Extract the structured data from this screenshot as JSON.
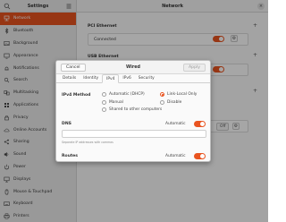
{
  "sidebar": {
    "title": "Settings",
    "items": [
      {
        "label": "Network",
        "icon": "network-icon",
        "active": true
      },
      {
        "label": "Bluetooth",
        "icon": "bluetooth-icon"
      },
      {
        "label": "Background",
        "icon": "background-icon"
      },
      {
        "label": "Appearance",
        "icon": "appearance-icon"
      },
      {
        "label": "Notifications",
        "icon": "bell-icon"
      },
      {
        "label": "Search",
        "icon": "search-icon"
      },
      {
        "label": "Multitasking",
        "icon": "multitasking-icon"
      },
      {
        "label": "Applications",
        "icon": "applications-icon",
        "chevron": true
      },
      {
        "label": "Privacy",
        "icon": "privacy-icon",
        "chevron": true
      },
      {
        "label": "Online Accounts",
        "icon": "cloud-icon"
      },
      {
        "label": "Sharing",
        "icon": "sharing-icon"
      },
      {
        "label": "Sound",
        "icon": "sound-icon"
      },
      {
        "label": "Power",
        "icon": "power-icon"
      },
      {
        "label": "Displays",
        "icon": "display-icon"
      },
      {
        "label": "Mouse & Touchpad",
        "icon": "mouse-icon"
      },
      {
        "label": "Keyboard",
        "icon": "keyboard-icon"
      },
      {
        "label": "Printers",
        "icon": "printer-icon"
      }
    ]
  },
  "main": {
    "title": "Network",
    "pci_section": "PCI Ethernet",
    "pci_status": "Connected",
    "usb_section": "USB Ethernet",
    "off_label": "Off"
  },
  "dialog": {
    "title": "Wired",
    "cancel_label": "Cancel",
    "apply_label": "Apply",
    "tabs": [
      "Details",
      "Identity",
      "IPv4",
      "IPv6",
      "Security"
    ],
    "active_tab": "IPv4",
    "method_label": "IPv4 Method",
    "methods": {
      "automatic": "Automatic (DHCP)",
      "link_local": "Link-Local Only",
      "manual": "Manual",
      "disable": "Disable",
      "shared": "Shared to other computers"
    },
    "selected_method": "Link-Local Only",
    "dns_label": "DNS",
    "dns_automatic_label": "Automatic",
    "dns_hint": "Separate IP addresses with commas",
    "routes_label": "Routes",
    "routes_automatic_label": "Automatic"
  },
  "colors": {
    "accent": "#e95420",
    "overlay": "rgba(0,0,0,0.35)"
  }
}
